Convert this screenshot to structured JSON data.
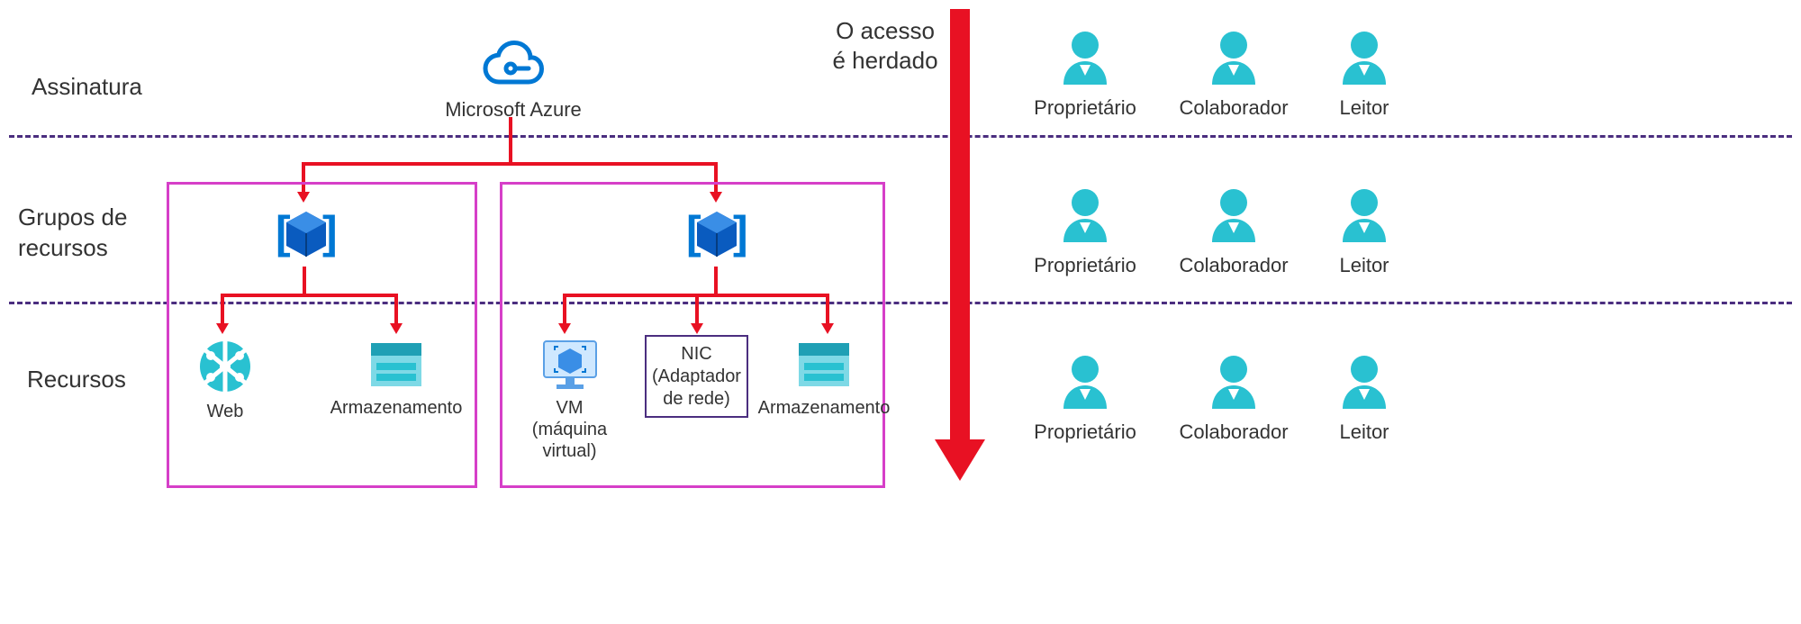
{
  "rows": {
    "subscription": "Assinatura",
    "resource_groups": "Grupos de\nrecursos",
    "resources": "Recursos"
  },
  "azure_label": "Microsoft Azure",
  "access_inherited": "O acesso\né herdado",
  "roles": {
    "owner": "Proprietário",
    "contributor": "Colaborador",
    "reader": "Leitor"
  },
  "group1": {
    "res_web": "Web",
    "res_storage": "Armazenamento"
  },
  "group2": {
    "res_vm_line1": "VM",
    "res_vm_line2": "(máquina virtual)",
    "res_nic_line1": "NIC",
    "res_nic_line2": "(Adaptador",
    "res_nic_line3": "de rede)",
    "res_storage": "Armazenamento"
  },
  "colors": {
    "azure_blue": "#0078d4",
    "cyan": "#29c1d1",
    "red": "#e81123",
    "magenta": "#d63fc8",
    "purple": "#4b2e7f"
  }
}
